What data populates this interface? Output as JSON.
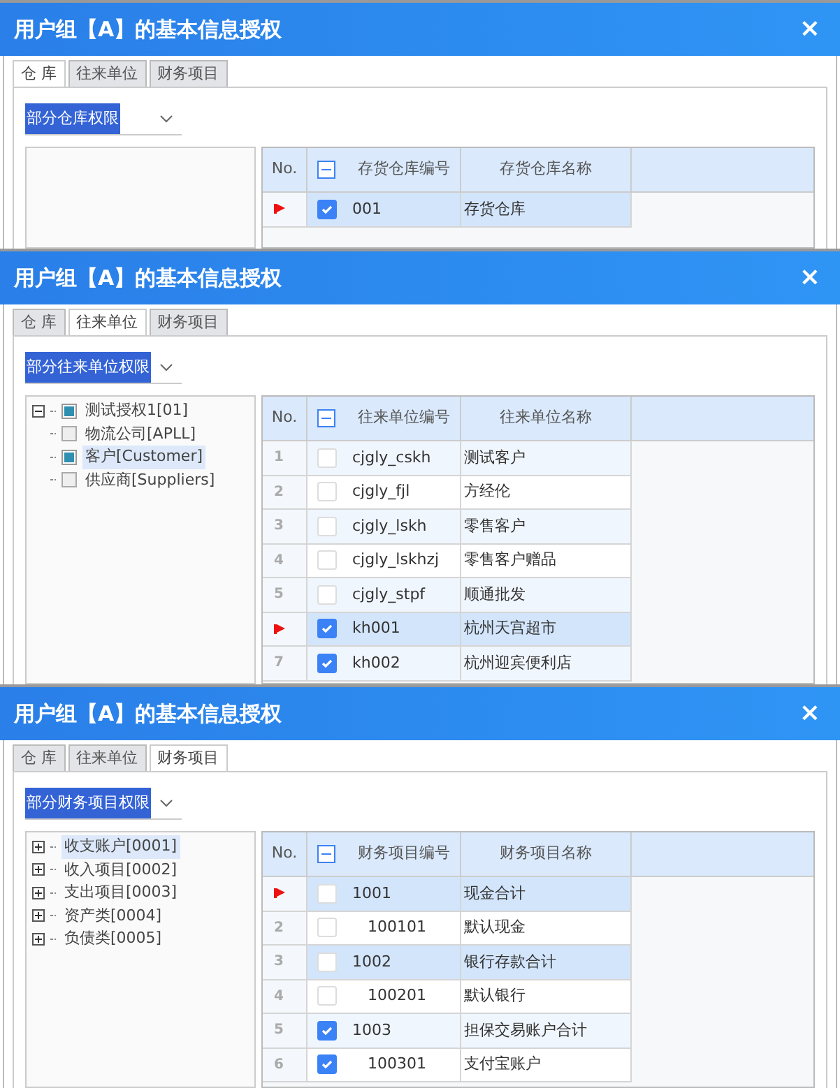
{
  "dialogs": [
    {
      "title": "用户组【A】的基本信息授权",
      "close": "×",
      "tabs": [
        {
          "label": "仓 库",
          "selected": true
        },
        {
          "label": "往来单位",
          "selected": false
        },
        {
          "label": "财务项目",
          "selected": false
        }
      ],
      "permission": "部分仓库权限",
      "grid": {
        "columns": [
          "No.",
          "存货仓库编号",
          "存货仓库名称"
        ],
        "indeterminate": true,
        "rows": [
          {
            "current": true,
            "checked": true,
            "selected": true,
            "kind": "parent",
            "code": "001",
            "name": "存货仓库"
          }
        ]
      }
    },
    {
      "title": "用户组【A】的基本信息授权",
      "close": "×",
      "tabs": [
        {
          "label": "仓 库",
          "selected": false
        },
        {
          "label": "往来单位",
          "selected": true
        },
        {
          "label": "财务项目",
          "selected": false
        }
      ],
      "permission": "部分往来单位权限",
      "tree": [
        {
          "label": "测试授权1[01]",
          "kind": "checkable",
          "expandable": true,
          "expanded": true,
          "checked": true,
          "selected": false
        },
        {
          "label": "物流公司[APLL]",
          "kind": "checkable",
          "expandable": false,
          "checked": false,
          "selected": false
        },
        {
          "label": "客户[Customer]",
          "kind": "checkable",
          "expandable": false,
          "checked": true,
          "selected": true
        },
        {
          "label": "供应商[Suppliers]",
          "kind": "checkable",
          "expandable": false,
          "checked": false,
          "selected": false
        }
      ],
      "grid": {
        "columns": [
          "No.",
          "往来单位编号",
          "往来单位名称"
        ],
        "indeterminate": true,
        "rows": [
          {
            "no": "1",
            "current": false,
            "checked": false,
            "selected": false,
            "kind": "parent",
            "code": "cjgly_cskh",
            "name": "测试客户"
          },
          {
            "no": "2",
            "current": false,
            "checked": false,
            "selected": false,
            "kind": "parent",
            "code": "cjgly_fjl",
            "name": "方经伦"
          },
          {
            "no": "3",
            "current": false,
            "checked": false,
            "selected": false,
            "kind": "parent",
            "code": "cjgly_lskh",
            "name": "零售客户"
          },
          {
            "no": "4",
            "current": false,
            "checked": false,
            "selected": false,
            "kind": "parent",
            "code": "cjgly_lskhzj",
            "name": "零售客户赠品"
          },
          {
            "no": "5",
            "current": false,
            "checked": false,
            "selected": false,
            "kind": "parent",
            "code": "cjgly_stpf",
            "name": "顺通批发"
          },
          {
            "current": true,
            "checked": true,
            "selected": true,
            "kind": "parent",
            "code": "kh001",
            "name": "杭州天宫超市"
          },
          {
            "no": "7",
            "current": false,
            "checked": true,
            "selected": false,
            "kind": "parent",
            "code": "kh002",
            "name": "杭州迎宾便利店"
          }
        ]
      }
    },
    {
      "title": "用户组【A】的基本信息授权",
      "close": "×",
      "tabs": [
        {
          "label": "仓 库",
          "selected": false
        },
        {
          "label": "往来单位",
          "selected": false
        },
        {
          "label": "财务项目",
          "selected": true
        }
      ],
      "permission": "部分财务项目权限",
      "tree": [
        {
          "label": "收支账户[0001]",
          "kind": "plain",
          "expandable": true,
          "expanded": false,
          "selected": true
        },
        {
          "label": "收入项目[0002]",
          "kind": "plain",
          "expandable": true,
          "expanded": false,
          "selected": false
        },
        {
          "label": "支出项目[0003]",
          "kind": "plain",
          "expandable": true,
          "expanded": false,
          "selected": false
        },
        {
          "label": "资产类[0004]",
          "kind": "plain",
          "expandable": true,
          "expanded": false,
          "selected": false
        },
        {
          "label": "负债类[0005]",
          "kind": "plain",
          "expandable": true,
          "expanded": false,
          "selected": false
        }
      ],
      "grid": {
        "columns": [
          "No.",
          "财务项目编号",
          "财务项目名称"
        ],
        "indeterminate": true,
        "rows": [
          {
            "current": true,
            "checked": false,
            "selected": true,
            "kind": "parent",
            "code": "1001",
            "name": "现金合计"
          },
          {
            "no": "2",
            "current": false,
            "checked": false,
            "selected": false,
            "kind": "child",
            "code": "100101",
            "name": "默认现金"
          },
          {
            "no": "3",
            "current": false,
            "checked": false,
            "selected": true,
            "kind": "parent",
            "code": "1002",
            "name": "银行存款合计"
          },
          {
            "no": "4",
            "current": false,
            "checked": false,
            "selected": false,
            "kind": "child",
            "code": "100201",
            "name": "默认银行"
          },
          {
            "no": "5",
            "current": false,
            "checked": true,
            "selected": false,
            "kind": "parent",
            "code": "1003",
            "name": "担保交易账户合计"
          },
          {
            "no": "6",
            "current": false,
            "checked": true,
            "selected": false,
            "kind": "child",
            "code": "100301",
            "name": "支付宝账户"
          }
        ]
      }
    }
  ]
}
